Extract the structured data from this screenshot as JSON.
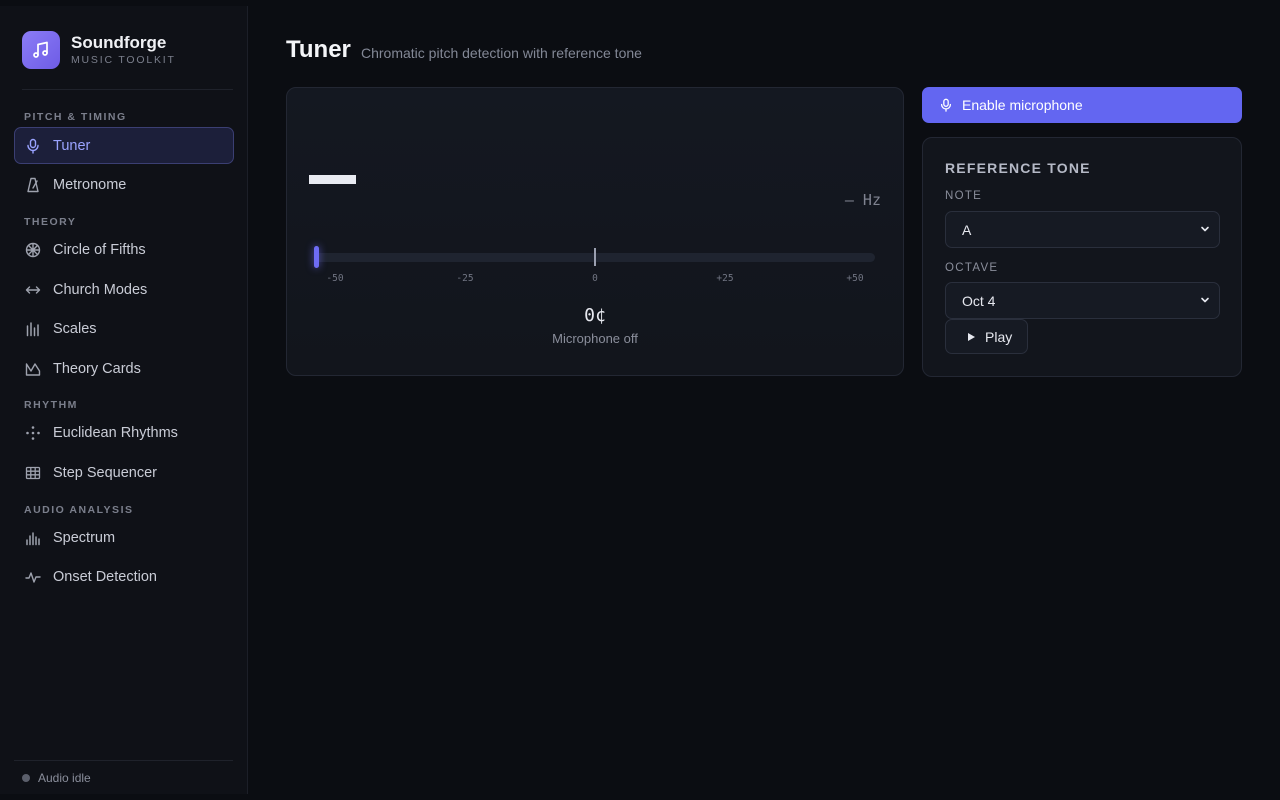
{
  "brand": {
    "name": "Soundforge",
    "subtitle": "MUSIC TOOLKIT",
    "logo_icon": "music-note-icon",
    "accent_color": "#7c6cf0"
  },
  "sidebar": {
    "sections": [
      {
        "label": "PITCH & TIMING",
        "items": [
          {
            "label": "Tuner",
            "icon": "microphone-icon",
            "active": true
          },
          {
            "label": "Metronome",
            "icon": "metronome-icon"
          }
        ]
      },
      {
        "label": "THEORY",
        "items": [
          {
            "label": "Circle of Fifths",
            "icon": "circle-of-fifths-icon"
          },
          {
            "label": "Church Modes",
            "icon": "arrows-horizontal-icon"
          },
          {
            "label": "Scales",
            "icon": "bars-icon"
          },
          {
            "label": "Theory Cards",
            "icon": "cards-icon"
          }
        ]
      },
      {
        "label": "RHYTHM",
        "items": [
          {
            "label": "Euclidean Rhythms",
            "icon": "dots-icon"
          },
          {
            "label": "Step Sequencer",
            "icon": "grid-icon"
          }
        ]
      },
      {
        "label": "AUDIO ANALYSIS",
        "items": [
          {
            "label": "Spectrum",
            "icon": "spectrum-icon"
          },
          {
            "label": "Onset Detection",
            "icon": "pulse-icon"
          }
        ]
      }
    ],
    "footer_status": "Audio idle"
  },
  "header": {
    "title": "Tuner",
    "subtitle": "Chromatic pitch detection with reference tone"
  },
  "tuner": {
    "hz_readout": "— Hz",
    "cents_readout": "0¢",
    "status": "Microphone off",
    "tick_labels": [
      "-50",
      "-25",
      "0",
      "+25",
      "+50"
    ],
    "needle_cents": -50
  },
  "controls": {
    "enable_mic_label": "Enable microphone",
    "reference": {
      "title": "REFERENCE TONE",
      "note_label": "NOTE",
      "note_value": "A",
      "octave_label": "OCTAVE",
      "octave_value": "Oct 4",
      "play_label": "Play"
    }
  }
}
